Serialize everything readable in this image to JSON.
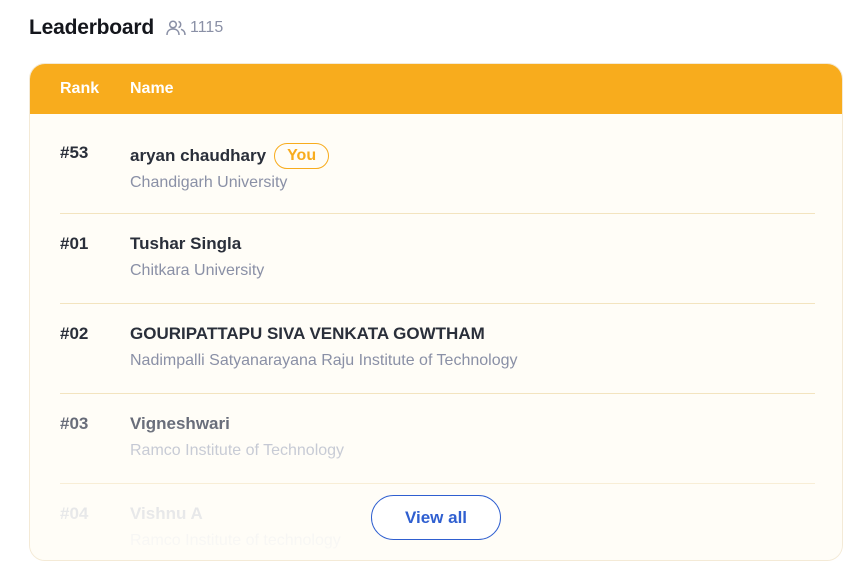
{
  "header": {
    "title": "Leaderboard",
    "participant_count": "1115",
    "participants_icon": "users-icon"
  },
  "table": {
    "columns": [
      "Rank",
      "Name"
    ],
    "rows": [
      {
        "rank": "#53",
        "name": "aryan chaudhary",
        "badge": "You",
        "institution": "Chandigarh University"
      },
      {
        "rank": "#01",
        "name": "Tushar Singla",
        "institution": "Chitkara University"
      },
      {
        "rank": "#02",
        "name": "GOURIPATTAPU SIVA VENKATA GOWTHAM",
        "institution": "Nadimpalli Satyanarayana Raju Institute of Technology"
      },
      {
        "rank": "#03",
        "name": "Vigneshwari",
        "institution": "Ramco Institute of Technology"
      },
      {
        "rank": "#04",
        "name": "Vishnu A",
        "institution": "Ramco Institute of technology"
      }
    ]
  },
  "actions": {
    "view_all_label": "View all"
  },
  "colors": {
    "accent": "#f8ac1d",
    "link": "#2f5fd0"
  }
}
